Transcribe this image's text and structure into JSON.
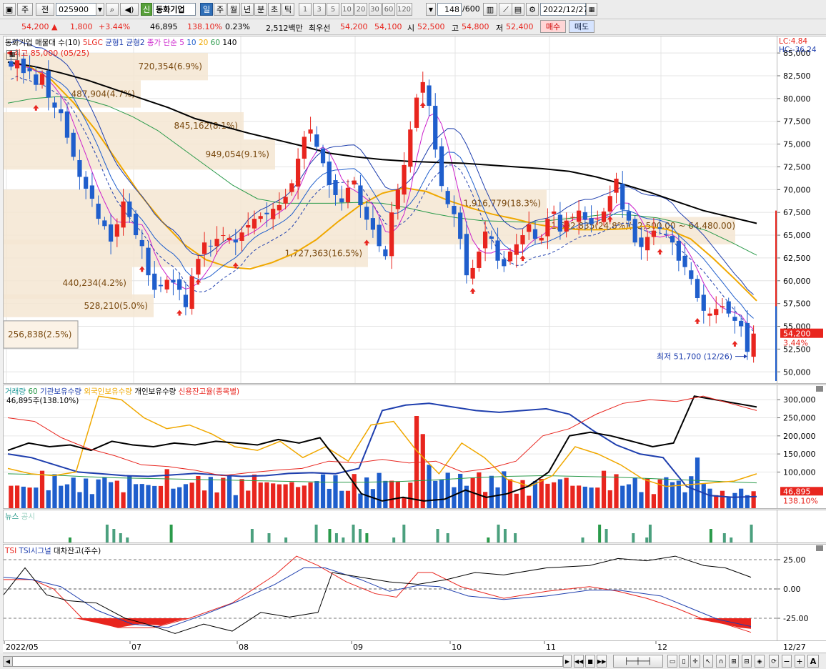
{
  "toolbar": {
    "kind_label": "주",
    "prev_label": "전",
    "code": "025900",
    "company_badge": "신",
    "company_name": "동화기업",
    "periods": [
      "일",
      "주",
      "월",
      "년",
      "분",
      "초",
      "틱"
    ],
    "ranges": [
      "1",
      "3",
      "5",
      "10",
      "20",
      "30",
      "60",
      "120"
    ],
    "count": "148",
    "count_total": "/600",
    "date": "2022/12/27"
  },
  "quote": {
    "price": "54,200 ▲",
    "change": "1,800",
    "change_pct": "+3.44%",
    "volume": "46,895",
    "vol_ratio": "138.10%",
    "turnover_rate": "0.23%",
    "amount": "2,512백만",
    "best_ask_label": "최우선",
    "best_ask": "54,200",
    "best_bid": "54,100",
    "open_label": "시",
    "open": "52,500",
    "high_label": "고",
    "high": "54,800",
    "low_label": "저",
    "low": "52,400",
    "buy_label": "매수",
    "sell_label": "매도"
  },
  "colors": {
    "up": "#e8251e",
    "down": "#1f5ecc",
    "ma5": "#cc22cc",
    "ma20": "#f0a800",
    "ma60": "#2a9a4a",
    "ma140": "#000000",
    "band": "#f5e6d2"
  },
  "price_panel": {
    "legend": [
      {
        "text": "동화기업 매물대 수(10)",
        "color": "#000000"
      },
      {
        "text": "5LGC",
        "color": "#e8251e"
      },
      {
        "text": "균형1",
        "color": "#1f3fae"
      },
      {
        "text": "균형2",
        "color": "#1f3fae"
      },
      {
        "text": "종가 단순 5",
        "color": "#cc22cc"
      },
      {
        "text": "10",
        "color": "#1f5ecc"
      },
      {
        "text": "20",
        "color": "#f0a800"
      },
      {
        "text": "60",
        "color": "#2a9a4a"
      },
      {
        "text": "140",
        "color": "#000000"
      }
    ],
    "lc_label": "LC:4.84",
    "hc_label": "HC:-36.24",
    "high_note": "최고 85,000 (05/25)",
    "low_note": "최저 51,700 (12/26)",
    "last_price_tag": "54,200",
    "last_pct_tag": "3.44%",
    "peak_annotation": "1,692,835(24.8%)(62,500.00 ~ 64,480.00)"
  },
  "volume_panel": {
    "legend": [
      {
        "text": "거래량",
        "color": "#1f9a9a"
      },
      {
        "text": "60",
        "color": "#2a9a4a"
      },
      {
        "text": "기관보유수량",
        "color": "#1f3fae"
      },
      {
        "text": "외국인보유수량",
        "color": "#f0a800"
      },
      {
        "text": "개인보유수량",
        "color": "#000000"
      },
      {
        "text": "신용잔고율(종목별)",
        "color": "#e8251e"
      }
    ],
    "sub_label": "46,895주(138.10%)",
    "ticks": [
      "300,000",
      "250,000",
      "200,000",
      "150,000",
      "100,000"
    ],
    "tag_value": "46,895",
    "tag_pct": "138.10%"
  },
  "news_panel": {
    "legend": [
      {
        "text": "뉴스",
        "color": "#2a9a8a"
      },
      {
        "text": "공시",
        "color": "#9ad0c0"
      }
    ]
  },
  "tsi_panel": {
    "legend": [
      {
        "text": "TSI",
        "color": "#e8251e"
      },
      {
        "text": "TSI시그널",
        "color": "#1f3fae"
      },
      {
        "text": "대차잔고(주수)",
        "color": "#000000"
      }
    ],
    "ticks": [
      "25.00",
      "0.00",
      "-25.00"
    ]
  },
  "xaxis": {
    "labels": [
      "2022/05",
      "07",
      "08",
      "09",
      "10",
      "11",
      "12"
    ],
    "end_label": "12/27"
  },
  "chart_data": {
    "type": "candlestick",
    "title": "동화기업 025900 일봉",
    "x_range": [
      "2022/05",
      "2022/12/27"
    ],
    "ylim": [
      49000,
      86500
    ],
    "y_ticks": [
      "85,000",
      "82,500",
      "80,000",
      "77,500",
      "75,000",
      "72,500",
      "70,000",
      "67,500",
      "65,000",
      "62,500",
      "60,000",
      "57,500",
      "55,000",
      "52,500",
      "50,000"
    ],
    "last": {
      "open": 52500,
      "high": 54800,
      "low": 52400,
      "close": 54200
    },
    "highest": {
      "value": 85000,
      "date": "05/25"
    },
    "lowest": {
      "value": 51700,
      "date": "12/26"
    },
    "volume_profile": [
      {
        "label": "720,354(6.9%)",
        "low": 82000,
        "high": 85000
      },
      {
        "label": "487,904(4.7%)",
        "low": 79000,
        "high": 82000
      },
      {
        "label": "845,162(8.1%)",
        "low": 75500,
        "high": 78500
      },
      {
        "label": "949,054(9.1%)",
        "low": 72200,
        "high": 75500
      },
      {
        "label": "1,916,779(18.3%)",
        "low": 67000,
        "high": 70000
      },
      {
        "label": "1,692,835(24.8%)",
        "low": 64000,
        "high": 67000
      },
      {
        "label": "1,727,363(16.5%)",
        "low": 61500,
        "high": 64500
      },
      {
        "label": "440,234(4.2%)",
        "low": 58000,
        "high": 61500
      },
      {
        "label": "528,210(5.0%)",
        "low": 56000,
        "high": 58500
      },
      {
        "label": "256,838(2.5%)",
        "low": 52600,
        "high": 55600
      }
    ],
    "close_series": [
      83500,
      84200,
      82800,
      83000,
      81500,
      82700,
      80100,
      79000,
      78400,
      75700,
      73600,
      71400,
      70100,
      69000,
      66800,
      66000,
      64300,
      66200,
      68700,
      67000,
      65000,
      63800,
      60600,
      59000,
      59400,
      60100,
      59800,
      59000,
      57100,
      60500,
      62400,
      64200,
      63800,
      64600,
      65000,
      64700,
      64200,
      65300,
      66100,
      66800,
      67100,
      67300,
      67900,
      68300,
      69200,
      70700,
      73400,
      75800,
      76600,
      74700,
      72900,
      70500,
      69400,
      68600,
      70200,
      71000,
      68300,
      66700,
      65600,
      63800,
      62700,
      67500,
      70000,
      72700,
      76600,
      80100,
      81800,
      79200,
      74400,
      70400,
      68400,
      67300,
      64600,
      60600,
      61400,
      63200,
      65400,
      64600,
      62200,
      61600,
      63200,
      64000,
      65000,
      66200,
      64600,
      64700,
      66800,
      67600,
      65400,
      66600,
      67000,
      67700,
      66700,
      66200,
      66800,
      67600,
      69300,
      71200,
      67800,
      66600,
      64200,
      63700,
      64800,
      65500,
      65700,
      65100,
      64200,
      62200,
      61500,
      60200,
      58100,
      56700,
      56400,
      56900,
      57200,
      56400,
      55600,
      55000,
      52200,
      54200
    ],
    "ma140": [
      84000,
      83500,
      82800,
      82000,
      81000,
      80000,
      79000,
      77800,
      77000,
      76200,
      75500,
      74800,
      74000,
      73600,
      73300,
      73100,
      73000,
      72900,
      72700,
      72500,
      72300,
      72000,
      71400,
      70600,
      69700,
      68700,
      67700,
      67000,
      66300
    ],
    "ma60": [
      79500,
      80000,
      80200,
      80000,
      79200,
      78000,
      76500,
      74500,
      72500,
      70500,
      69000,
      68500,
      68500,
      68500,
      68600,
      68500,
      68000,
      67400,
      66900,
      66600,
      66500,
      66400,
      66700,
      67000,
      67300,
      67200,
      66900,
      66300,
      65500,
      64200,
      62800
    ],
    "ma20": [
      84000,
      83500,
      82000,
      79500,
      76500,
      73000,
      69500,
      66500,
      64000,
      62300,
      61500,
      61300,
      62000,
      63000,
      64500,
      66500,
      68300,
      69600,
      70200,
      69800,
      68800,
      68000,
      67300,
      66800,
      66200,
      65800,
      65600,
      65600,
      65700,
      66000,
      65600,
      64600,
      62500,
      60200,
      57800
    ],
    "volume": {
      "latest": 46895,
      "ratio_pct": 138.1
    },
    "tsi": {
      "range": [
        -35,
        30
      ],
      "gridlines": [
        25,
        0,
        -25
      ]
    }
  }
}
